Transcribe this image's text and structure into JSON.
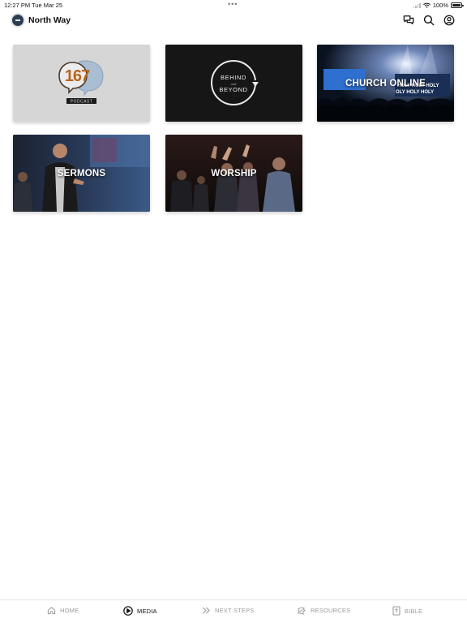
{
  "status_bar": {
    "time": "12:27 PM",
    "date": "Tue Mar 25",
    "battery": "100%"
  },
  "header": {
    "title": "North Way",
    "icons": [
      "chat-icon",
      "search-icon",
      "account-icon"
    ]
  },
  "media_cards": [
    {
      "label": "",
      "badge_number": "167",
      "badge_text": "PODCAST"
    },
    {
      "label": "",
      "logo_top": "BEHIND",
      "logo_mid": "and",
      "logo_bottom": "BEYOND"
    },
    {
      "label": "CHURCH ONLINE",
      "screen_text_1": "HOLY HOLY HOLY",
      "screen_text_2": "OLY HOLY HOLY"
    },
    {
      "label": "SERMONS"
    },
    {
      "label": "WORSHIP"
    }
  ],
  "tab_bar": {
    "active": "media",
    "tabs": [
      {
        "id": "home",
        "label": "HOME",
        "icon": "home-icon"
      },
      {
        "id": "media",
        "label": "MEDIA",
        "icon": "play-circle-icon"
      },
      {
        "id": "next_steps",
        "label": "NEXT STEPS",
        "icon": "double-chevron-icon"
      },
      {
        "id": "resources",
        "label": "RESOURCES",
        "icon": "resources-icon"
      },
      {
        "id": "bible",
        "label": "BIBLE",
        "icon": "bible-icon"
      }
    ]
  },
  "colors": {
    "active_tab": "#111111",
    "inactive_tab": "#9a9a9a",
    "logo": "#2c3e50"
  }
}
